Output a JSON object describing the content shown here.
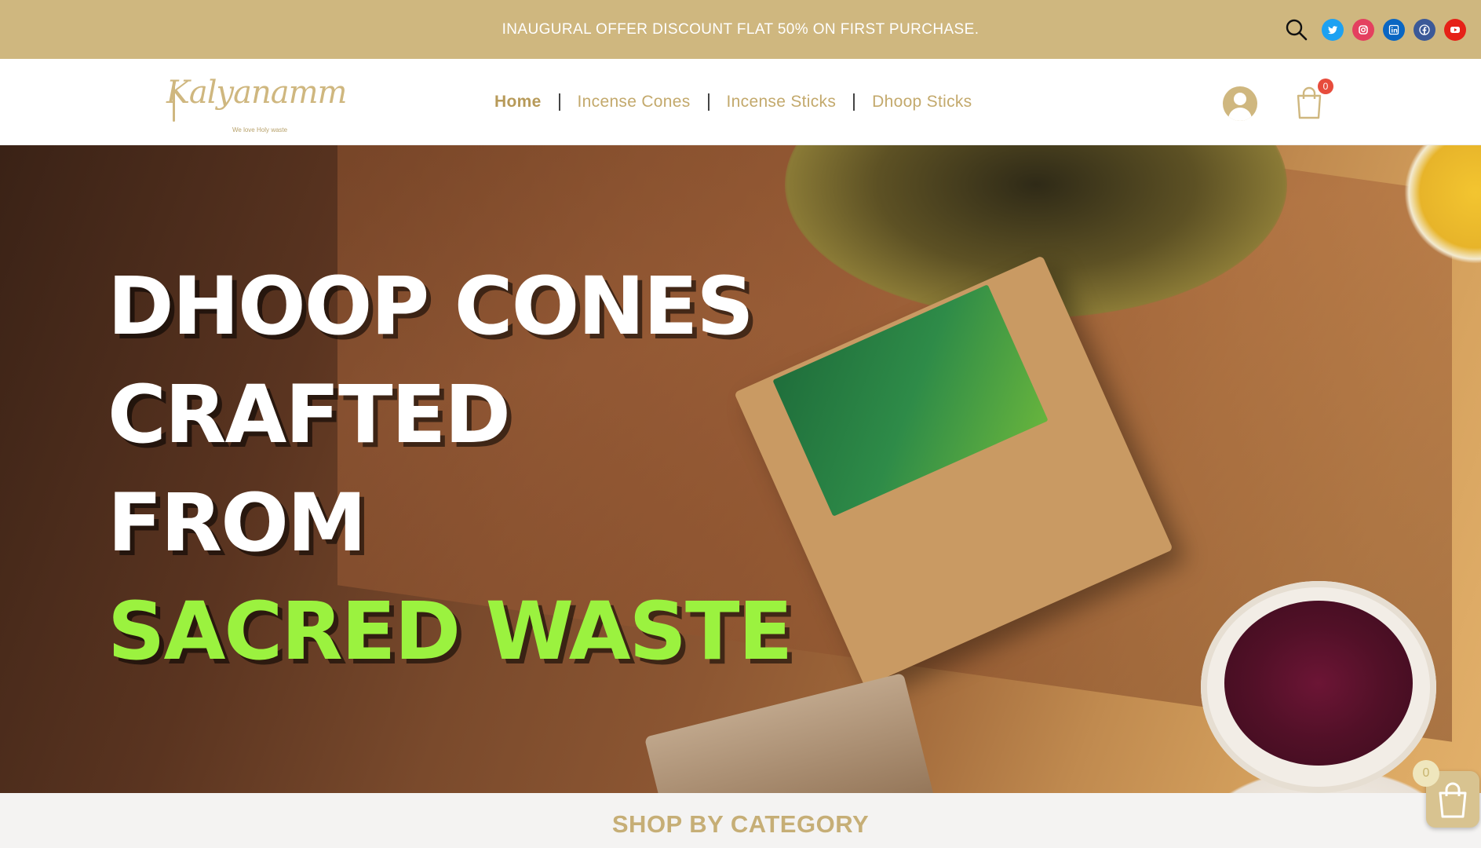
{
  "topbar": {
    "offer_text": "INAUGURAL OFFER DISCOUNT FLAT 50% ON FIRST PURCHASE.",
    "background": "#cfb77f",
    "social": [
      {
        "icon": "twitter-icon",
        "color": "#1da1f2"
      },
      {
        "icon": "instagram-icon",
        "color": "#e4405f"
      },
      {
        "icon": "linkedin-icon",
        "color": "#0a66c2"
      },
      {
        "icon": "facebook-icon",
        "color": "#3b5998"
      },
      {
        "icon": "youtube-icon",
        "color": "#e62117"
      }
    ]
  },
  "logo": {
    "script": "Kalyanamm",
    "tagline": "We love Holy waste"
  },
  "nav": {
    "items": [
      "Home",
      "Incense Cones",
      "Incense Sticks",
      "Dhoop Sticks"
    ],
    "active": "Home",
    "cart_count": "0"
  },
  "hero": {
    "line1": "DHOOP CONES",
    "line2": "CRAFTED",
    "line3": "FROM",
    "line4": "SACRED WASTE",
    "accent_color": "#9bf23f"
  },
  "section": {
    "title": "SHOP BY CATEGORY"
  },
  "float_cart": {
    "count": "0"
  }
}
